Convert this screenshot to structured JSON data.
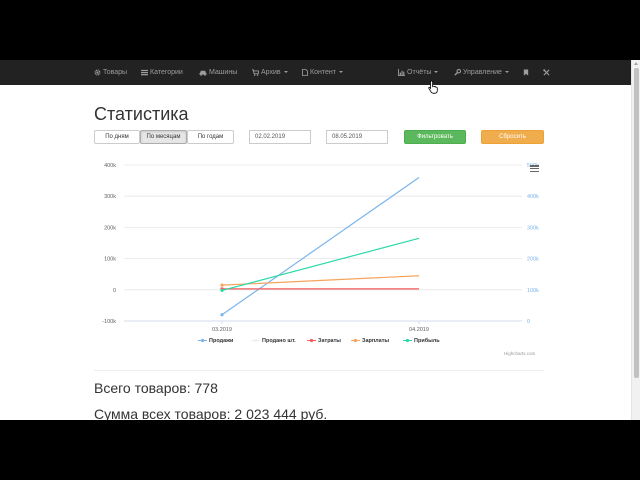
{
  "nav": {
    "items": [
      {
        "label": "Товары",
        "icon": "gear-icon"
      },
      {
        "label": "Категории",
        "icon": "list-icon"
      },
      {
        "label": "Машины",
        "icon": "car-icon"
      },
      {
        "label": "Архив",
        "icon": "cart-icon"
      },
      {
        "label": "Контент",
        "icon": "file-icon"
      },
      {
        "label": "Отчёты",
        "icon": "bar-chart-icon"
      },
      {
        "label": "Управление",
        "icon": "wrench-icon"
      }
    ],
    "extra_icons": [
      "bookmark-icon",
      "tools-icon"
    ]
  },
  "page": {
    "title": "Статистика"
  },
  "filters": {
    "period_buttons": [
      "По дням",
      "По месяцам",
      "По годам"
    ],
    "active_period": "По месяцам",
    "date_from": "02.02.2019",
    "date_to": "08.05.2019",
    "filter_button": "Фильтровать",
    "reset_button": "Сбросить"
  },
  "colors": {
    "navbar": "#222222",
    "success": "#5cb85c",
    "warning": "#f0ad4e"
  },
  "chart_data": {
    "type": "line",
    "categories": [
      "03.2019",
      "04.2019"
    ],
    "left_axis": {
      "ticks": [
        "400k",
        "300k",
        "200k",
        "100k",
        "0",
        "-100k"
      ],
      "ylim": [
        -100000,
        400000
      ]
    },
    "right_axis": {
      "ticks": [
        "500k",
        "400k",
        "300k",
        "200k",
        "100k",
        "0"
      ],
      "ylim": [
        0,
        500000
      ]
    },
    "series": [
      {
        "name": "Продажи",
        "color": "#7cb5ec",
        "axis": "right",
        "values": [
          20000,
          460000
        ]
      },
      {
        "name": "Продано шт.",
        "color": "#f0f0f0",
        "axis": "left",
        "values": [
          0,
          0
        ]
      },
      {
        "name": "Затраты",
        "color": "#f45b5b",
        "axis": "left",
        "values": [
          3000,
          3000
        ]
      },
      {
        "name": "Зарплаты",
        "color": "#f7a35c",
        "axis": "left",
        "values": [
          15000,
          45000
        ]
      },
      {
        "name": "Прибыль",
        "color": "#2bd9a8",
        "axis": "left",
        "values": [
          -2000,
          165000
        ]
      }
    ],
    "grid": true,
    "legend": "bottom",
    "credits": "Highcharts.com"
  },
  "stats": {
    "total_products": "Всего товаров: 778",
    "total_sum": "Сумма всех товаров: 2 023 444 руб."
  }
}
